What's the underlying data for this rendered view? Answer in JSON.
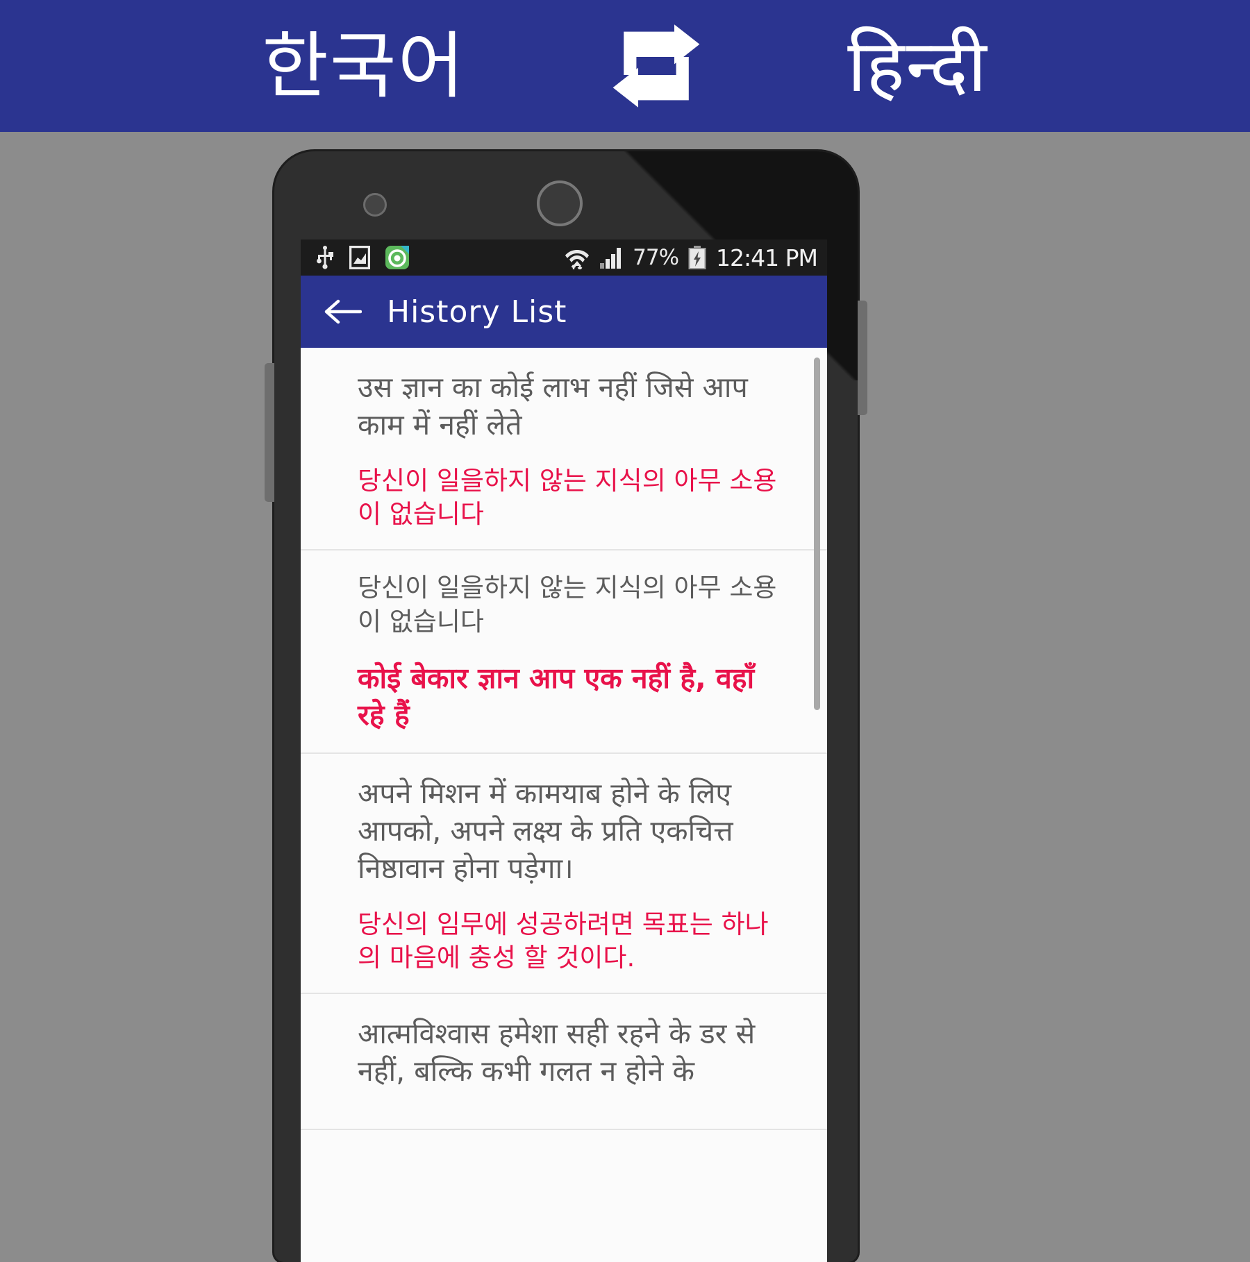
{
  "banner": {
    "source_language": "한국어",
    "swap_icon": "repeat-swap-icon",
    "target_language": "हिन्दी",
    "background_color": "#2b3490"
  },
  "phone": {
    "status_bar": {
      "icons_left": [
        "usb-icon",
        "screenshot-icon",
        "app-icon"
      ],
      "icons_right": [
        "wifi-icon",
        "cellular-signal-icon"
      ],
      "battery_percent": "77%",
      "battery_state": "charging",
      "clock": "12:41 PM",
      "background_color": "#1c1c1c"
    },
    "action_bar": {
      "back_icon": "back-arrow-icon",
      "title": "History List",
      "background_color": "#2b3490"
    },
    "history": {
      "items": [
        {
          "source": "उस ज्ञान का कोई लाभ नहीं जिसे आप काम में नहीं लेते",
          "source_lang": "hindi",
          "translation": "당신이 일을하지 않는 지식의 아무 소용이 없습니다",
          "translation_lang": "korean",
          "translation_bold": false
        },
        {
          "source": "당신이 일을하지 않는 지식의 아무 소용이 없습니다",
          "source_lang": "korean",
          "translation": "कोई बेकार ज्ञान आप एक नहीं है, वहाँ रहे हैं",
          "translation_lang": "hindi",
          "translation_bold": true
        },
        {
          "source": "अपने मिशन में कामयाब होने के लिए आपको, अपने लक्ष्य के प्रति एकचित्त निष्ठावान होना पड़ेगा।",
          "source_lang": "hindi",
          "translation": "당신의 임무에 성공하려면 목표는 하나의 마음에 충성 할 것이다.",
          "translation_lang": "korean",
          "translation_bold": false
        },
        {
          "source": "आत्मविश्वास हमेशा सही रहने के डर से नहीं, बल्कि कभी गलत न होने के",
          "source_lang": "hindi",
          "translation": "",
          "translation_lang": "korean",
          "translation_bold": false
        }
      ],
      "accent_color": "#e8124a",
      "source_color": "#5c5c5c"
    }
  }
}
